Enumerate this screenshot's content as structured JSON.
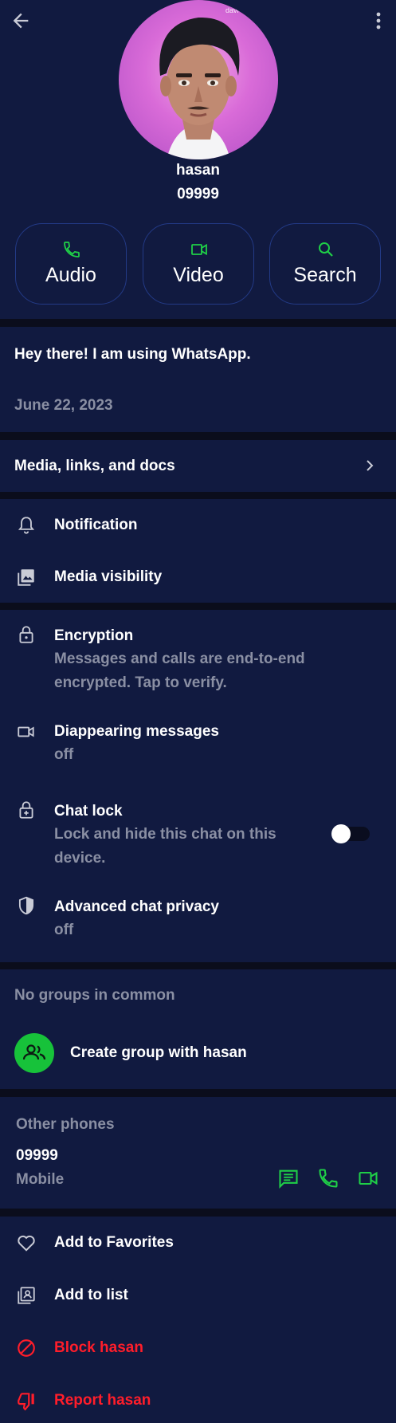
{
  "header": {
    "contact_name": "hasan",
    "phone": "09999",
    "avatar_watermark": "davi",
    "actions": [
      {
        "label": "Audio",
        "icon": "phone-icon"
      },
      {
        "label": "Video",
        "icon": "video-icon"
      },
      {
        "label": "Search",
        "icon": "search-icon"
      }
    ]
  },
  "about": {
    "status": "Hey there! I am using WhatsApp.",
    "date": "June 22, 2023"
  },
  "media": {
    "label": "Media, links, and docs"
  },
  "settings1": {
    "notification": "Notification",
    "media_visibility": "Media visibility"
  },
  "privacy": {
    "encryption_title": "Encryption",
    "encryption_sub1": "Messages and calls are end-to-end",
    "encryption_sub2": "encrypted. Tap to verify.",
    "disappearing_title": "Diappearing messages",
    "disappearing_value": "off",
    "chatlock_title": "Chat lock",
    "chatlock_sub1": "Lock and hide this chat on this",
    "chatlock_sub2": "device.",
    "chatlock_enabled": false,
    "advanced_title": "Advanced chat privacy",
    "advanced_value": "off"
  },
  "groups": {
    "heading": "No groups in common",
    "create_label": "Create group with hasan"
  },
  "phones": {
    "heading": "Other phones",
    "number": "09999",
    "type": "Mobile"
  },
  "actions": {
    "favorites": "Add to Favorites",
    "list": "Add to list",
    "block": "Block hasan",
    "report": "Report hasan"
  },
  "colors": {
    "background": "#111a40",
    "separator": "#0b0d1c",
    "accent_green": "#17c23a",
    "danger_red": "#ff1d2a",
    "muted_text": "#8a8fa3"
  }
}
